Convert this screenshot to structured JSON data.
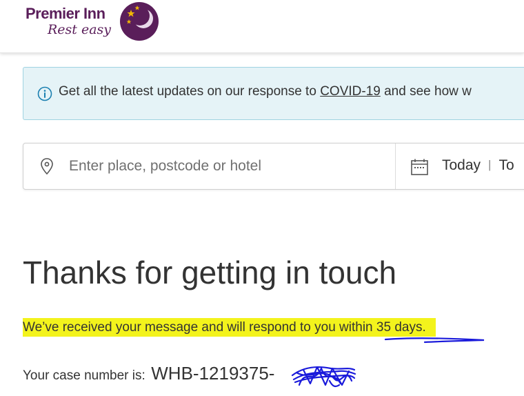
{
  "brand": {
    "name": "Premier Inn",
    "tagline": "Rest easy"
  },
  "covid_banner": {
    "text_before": "Get all the latest updates on our response to ",
    "link_text": "COVID-19",
    "text_after": " and see how w"
  },
  "search": {
    "placeholder": "Enter place, postcode or hotel",
    "date_from": "Today",
    "date_separator": "|",
    "date_to": "To"
  },
  "confirmation": {
    "title": "Thanks for getting in touch",
    "message": "We’ve received your message and will respond to you within 35 days.",
    "case_label": "Your case number is:",
    "case_number": "WHB-1219375-"
  },
  "colors": {
    "brand_purple": "#5a1e5a",
    "banner_bg": "#e5f3f7",
    "banner_border": "#9fd3e1",
    "highlight": "#f3f31c",
    "annotation_blue": "#1a1adb"
  },
  "icons": {
    "logo": "moon-icon",
    "banner": "info-icon",
    "search": "pin-icon",
    "dates": "calendar-icon"
  }
}
